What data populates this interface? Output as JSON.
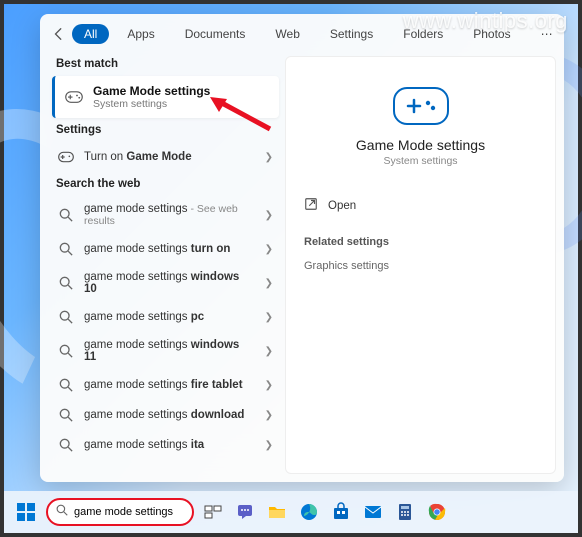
{
  "watermark": "www.wintips.org",
  "header": {
    "tabs": [
      "All",
      "Apps",
      "Documents",
      "Web",
      "Settings",
      "Folders",
      "Photos"
    ],
    "active_tab": "All"
  },
  "left": {
    "best_match_label": "Best match",
    "best_match": {
      "title": "Game Mode settings",
      "subtitle": "System settings"
    },
    "settings_label": "Settings",
    "settings_items": [
      {
        "prefix": "Turn on ",
        "bold": "Game Mode",
        "suffix": ""
      }
    ],
    "web_label": "Search the web",
    "web_items": [
      {
        "text": "game mode settings",
        "suffix": " - See web results"
      },
      {
        "text": "game mode settings ",
        "bold": "turn on"
      },
      {
        "text": "game mode settings ",
        "bold": "windows 10"
      },
      {
        "text": "game mode settings ",
        "bold": "pc"
      },
      {
        "text": "game mode settings ",
        "bold": "windows 11"
      },
      {
        "text": "game mode settings ",
        "bold": "fire tablet"
      },
      {
        "text": "game mode settings ",
        "bold": "download"
      },
      {
        "text": "game mode settings ",
        "bold": "ita"
      }
    ]
  },
  "right": {
    "title": "Game Mode settings",
    "subtitle": "System settings",
    "open_label": "Open",
    "related_label": "Related settings",
    "related_items": [
      "Graphics settings"
    ]
  },
  "taskbar": {
    "search_value": "game mode settings"
  }
}
